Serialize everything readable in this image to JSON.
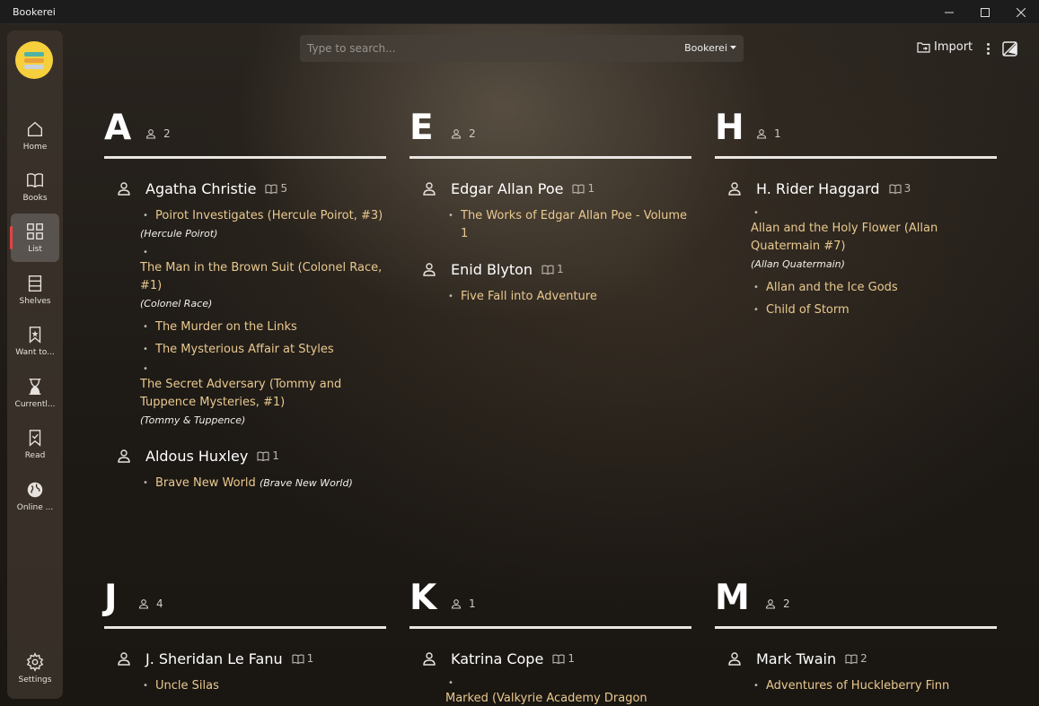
{
  "window": {
    "title": "Bookerei"
  },
  "sidebar": {
    "items": [
      {
        "label": "Home",
        "icon": "home-icon"
      },
      {
        "label": "Books",
        "icon": "book-icon"
      },
      {
        "label": "List",
        "icon": "grid-icon",
        "active": true
      },
      {
        "label": "Shelves",
        "icon": "shelves-icon"
      },
      {
        "label": "Want to...",
        "icon": "bookmark-icon"
      },
      {
        "label": "Currentl...",
        "icon": "hourglass-icon"
      },
      {
        "label": "Read",
        "icon": "bookmark-check-icon"
      },
      {
        "label": "Online ...",
        "icon": "globe-icon"
      },
      {
        "label": "Settings",
        "icon": "gear-icon"
      }
    ]
  },
  "topbar": {
    "search_placeholder": "Type to search...",
    "library": "Bookerei",
    "import_label": "Import"
  },
  "sections": [
    {
      "letter": "A",
      "count": "2",
      "authors": [
        {
          "name": "Agatha Christie",
          "book_count": "5",
          "books": [
            {
              "title": "Poirot Investigates (Hercule Poirot, #3)",
              "series": "(Hercule Poirot)"
            },
            {
              "title": "The Man in the Brown Suit (Colonel Race, #1)",
              "series": "(Colonel Race)"
            },
            {
              "title": "The Murder on the Links"
            },
            {
              "title": "The Mysterious Affair at Styles"
            },
            {
              "title": "The Secret Adversary (Tommy and Tuppence Mysteries, #1)",
              "series": "(Tommy & Tuppence)"
            }
          ]
        },
        {
          "name": "Aldous Huxley",
          "book_count": "1",
          "books": [
            {
              "title": "Brave New World",
              "series": "(Brave New World)"
            }
          ]
        }
      ]
    },
    {
      "letter": "E",
      "count": "2",
      "authors": [
        {
          "name": "Edgar Allan Poe",
          "book_count": "1",
          "books": [
            {
              "title": "The Works of Edgar Allan Poe - Volume 1"
            }
          ]
        },
        {
          "name": "Enid Blyton",
          "book_count": "1",
          "books": [
            {
              "title": "Five Fall into Adventure"
            }
          ]
        }
      ]
    },
    {
      "letter": "H",
      "count": "1",
      "authors": [
        {
          "name": "H. Rider Haggard",
          "book_count": "3",
          "books": [
            {
              "title": "Allan and the Holy Flower (Allan Quatermain #7)",
              "series": "(Allan Quatermain)"
            },
            {
              "title": "Allan and the Ice Gods"
            },
            {
              "title": "Child of Storm"
            }
          ]
        }
      ]
    },
    {
      "letter": "J",
      "count": "4",
      "authors": [
        {
          "name": "J. Sheridan Le Fanu",
          "book_count": "1",
          "books": [
            {
              "title": "Uncle Silas"
            }
          ]
        }
      ]
    },
    {
      "letter": "K",
      "count": "1",
      "authors": [
        {
          "name": "Katrina Cope",
          "book_count": "1",
          "books": [
            {
              "title": "Marked (Valkyrie Academy Dragon Alliance"
            }
          ]
        }
      ]
    },
    {
      "letter": "M",
      "count": "2",
      "authors": [
        {
          "name": "Mark Twain",
          "book_count": "2",
          "books": [
            {
              "title": "Adventures of Huckleberry Finn"
            }
          ]
        }
      ]
    }
  ]
}
